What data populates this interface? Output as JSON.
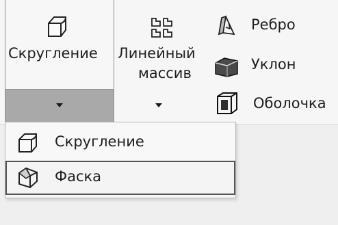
{
  "ribbon": {
    "fillet_button": {
      "label": "Скругление",
      "icon": "fillet-icon"
    },
    "linear_pattern": {
      "label_line1": "Линейный",
      "label_line2": "массив",
      "icon": "linear-pattern-icon"
    },
    "rib": {
      "label": "Ребро",
      "icon": "rib-icon"
    },
    "draft": {
      "label": "Уклон",
      "icon": "draft-icon"
    },
    "shell": {
      "label": "Оболочка",
      "icon": "shell-icon"
    }
  },
  "dropdown": {
    "items": [
      {
        "label": "Скругление",
        "icon": "fillet-icon",
        "highlighted": false
      },
      {
        "label": "Фаска",
        "icon": "chamfer-icon",
        "highlighted": true
      }
    ]
  },
  "colors": {
    "ribbon_bg": "#f6f6f6",
    "split_bottom": "#a9a9a9",
    "menu_bg": "#f8f8f8",
    "highlight_border": "#555555"
  }
}
